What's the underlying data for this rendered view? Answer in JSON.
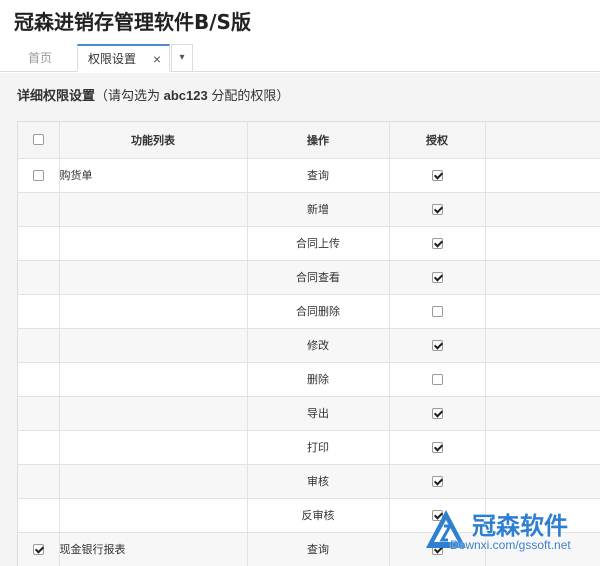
{
  "app_title": "冠森进销存管理软件B/S版",
  "tabs": {
    "home": "首页",
    "active": "权限设置",
    "close_glyph": "×",
    "more_glyph": "▾"
  },
  "section": {
    "title": "详细权限设置",
    "note_prefix": "（请勾选为 ",
    "user": "abc123",
    "note_suffix": " 分配的权限）"
  },
  "grid": {
    "columns": {
      "function": "功能列表",
      "operation": "操作",
      "authorize": "授权"
    },
    "rows": [
      {
        "checked_row": false,
        "function": "购货单",
        "operation": "查询",
        "authorized": true
      },
      {
        "function": "",
        "operation": "新增",
        "authorized": true
      },
      {
        "function": "",
        "operation": "合同上传",
        "authorized": true
      },
      {
        "function": "",
        "operation": "合同查看",
        "authorized": true
      },
      {
        "function": "",
        "operation": "合同删除",
        "authorized": false
      },
      {
        "function": "",
        "operation": "修改",
        "authorized": true
      },
      {
        "function": "",
        "operation": "删除",
        "authorized": false
      },
      {
        "function": "",
        "operation": "导出",
        "authorized": true
      },
      {
        "function": "",
        "operation": "打印",
        "authorized": true
      },
      {
        "function": "",
        "operation": "审核",
        "authorized": true
      },
      {
        "function": "",
        "operation": "反审核",
        "authorized": true
      },
      {
        "checked_row": true,
        "function": "现金银行报表",
        "operation": "查询",
        "authorized": true
      }
    ]
  },
  "watermark": {
    "title": "冠森软件",
    "subtitle": "Downxi.com/gssoft.net"
  },
  "colors": {
    "accent": "#4a8bd0",
    "watermark": "#2d7fd2"
  }
}
